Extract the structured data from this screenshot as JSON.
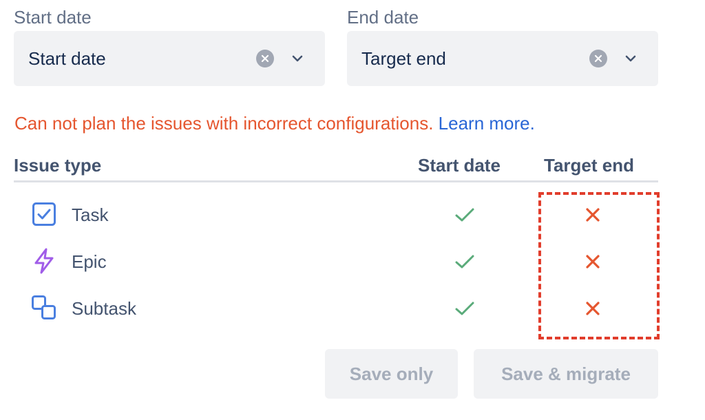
{
  "start_field": {
    "label": "Start date",
    "value": "Start date"
  },
  "end_field": {
    "label": "End date",
    "value": "Target end"
  },
  "error": {
    "message": "Can not plan the issues with incorrect configurations.",
    "link": "Learn more."
  },
  "table": {
    "headers": {
      "issue_type": "Issue type",
      "start_date": "Start date",
      "target_end": "Target end"
    },
    "rows": [
      {
        "label": "Task",
        "icon": "task-checkbox-icon",
        "start_ok": true,
        "end_ok": false
      },
      {
        "label": "Epic",
        "icon": "epic-lightning-icon",
        "start_ok": true,
        "end_ok": false
      },
      {
        "label": "Subtask",
        "icon": "subtask-icon",
        "start_ok": true,
        "end_ok": false
      }
    ]
  },
  "buttons": {
    "save_only": "Save only",
    "save_migrate": "Save & migrate"
  },
  "colors": {
    "error": "#e5562f",
    "link": "#2966d6",
    "ok": "#5aab7a",
    "fail": "#e5562f",
    "highlight": "#e13d2c"
  }
}
